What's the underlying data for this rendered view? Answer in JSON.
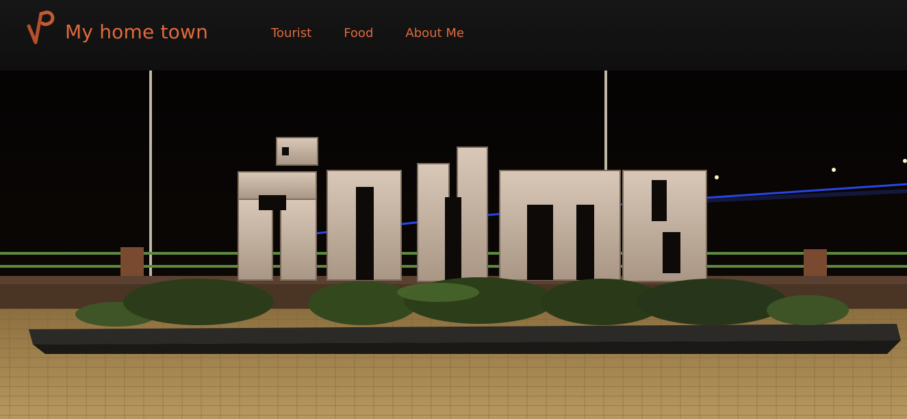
{
  "header": {
    "brand_title": "My home town",
    "logo_icon": "vp-monogram-icon",
    "accent_color": "#e16a3c",
    "nav": [
      {
        "label": "Tourist"
      },
      {
        "label": "Food"
      },
      {
        "label": "About Me"
      }
    ]
  },
  "hero": {
    "image_subject": "illuminated stone letter sign at riverside promenade at night",
    "sky_color": "#050303",
    "ground_color": "#a3864f",
    "bridge_light_color": "#2e4dff"
  }
}
